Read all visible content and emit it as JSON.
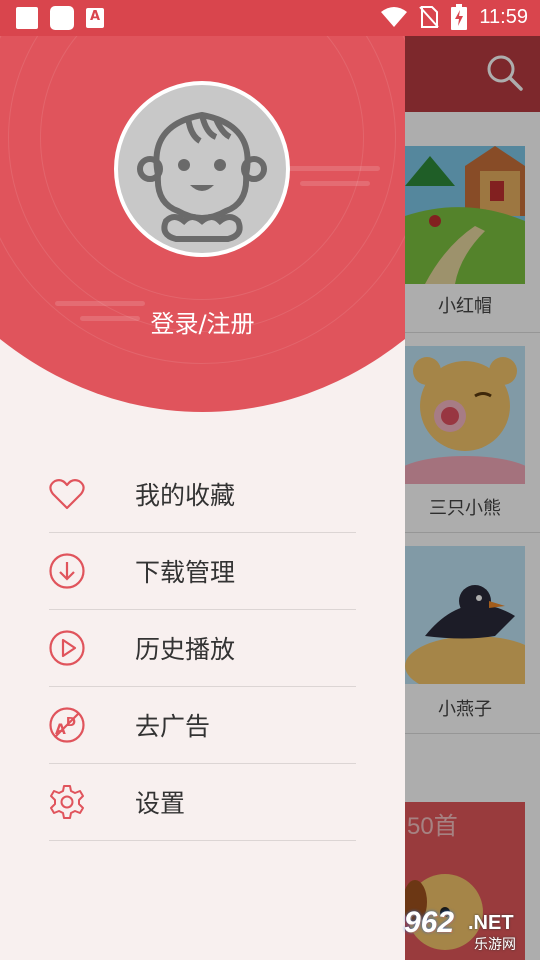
{
  "status_bar": {
    "time": "11:59",
    "icons": [
      "notification-square-icon",
      "notification-rounded-icon",
      "app-a-icon",
      "wifi-icon",
      "no-sim-icon",
      "battery-charging-icon"
    ]
  },
  "background": {
    "search_icon": "search-icon",
    "items": [
      {
        "label": "小红帽"
      },
      {
        "label": "三只小熊"
      },
      {
        "label": "小燕子"
      }
    ],
    "banner_text": "50首"
  },
  "drawer": {
    "login_label": "登录/注册",
    "menu": [
      {
        "label": "我的收藏",
        "icon": "heart-icon"
      },
      {
        "label": "下载管理",
        "icon": "download-icon"
      },
      {
        "label": "历史播放",
        "icon": "play-icon"
      },
      {
        "label": "去广告",
        "icon": "no-ads-icon"
      },
      {
        "label": "设置",
        "icon": "gear-icon"
      }
    ]
  },
  "watermark": {
    "number": "962",
    "domain": ".NET",
    "site": "乐游网"
  },
  "colors": {
    "primary_red": "#e0545c",
    "status_red": "#d9454d",
    "drawer_bg": "#f8f0ef",
    "icon_red": "#e0545c",
    "text_dark": "#333333"
  }
}
